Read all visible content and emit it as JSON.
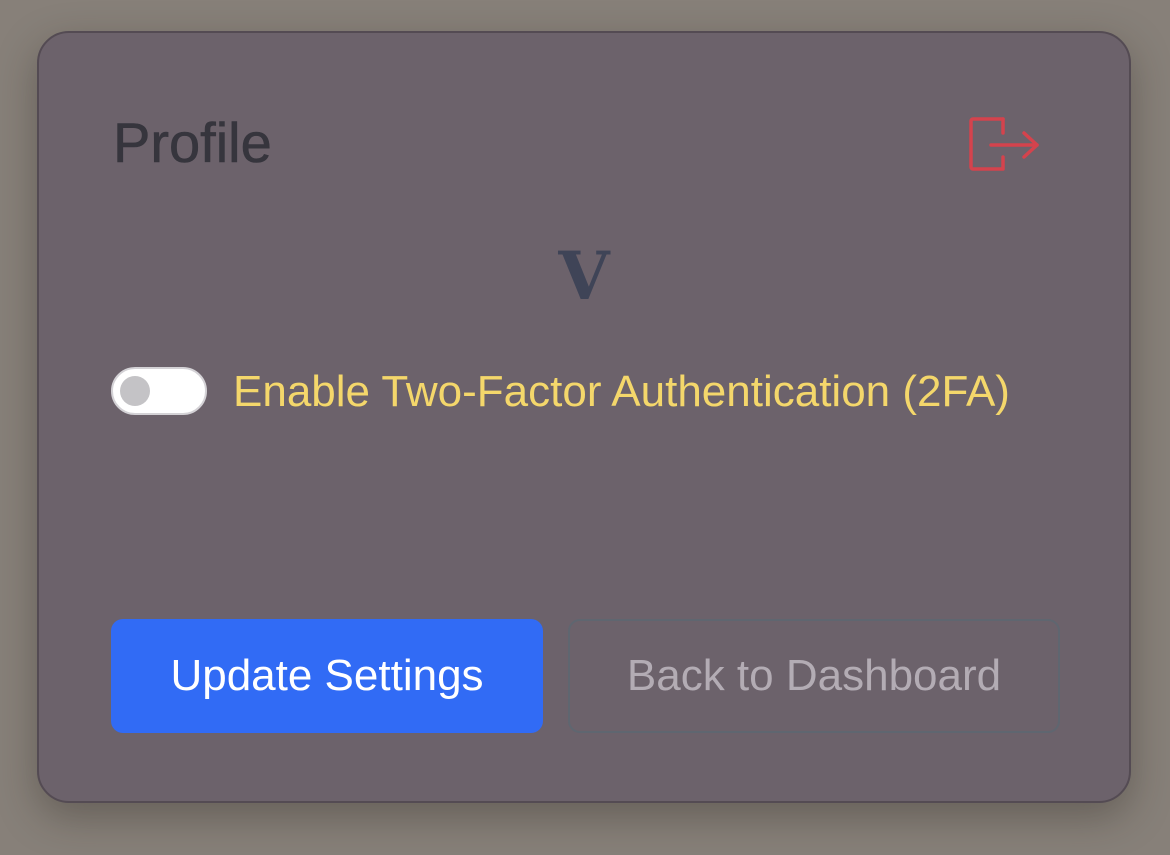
{
  "profile": {
    "title": "Profile",
    "avatar_initial": "V",
    "logout_icon": "logout-icon"
  },
  "security": {
    "two_factor_label": "Enable Two-Factor Authentication (2FA)",
    "two_factor_enabled": false
  },
  "actions": {
    "update_label": "Update Settings",
    "back_label": "Back to Dashboard"
  },
  "colors": {
    "background": "#878079",
    "card": "#6c626b",
    "title": "#36353d",
    "logout": "#d4434d",
    "avatar": "#3f4457",
    "label": "#f4d76b",
    "primary_button": "#316bf5",
    "secondary_text": "#b3acb4"
  }
}
